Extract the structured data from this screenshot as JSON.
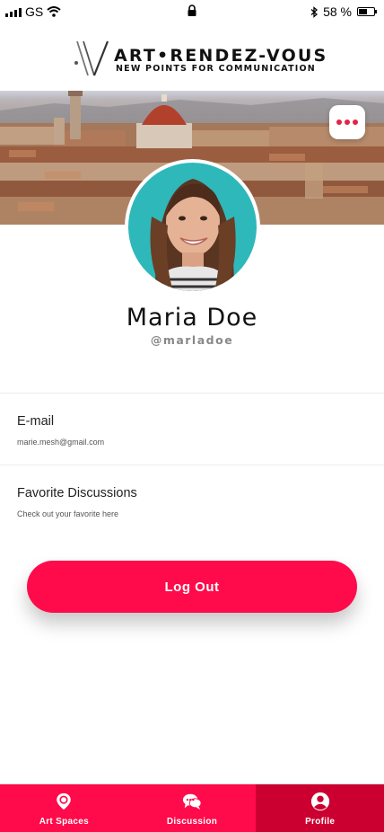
{
  "status_bar": {
    "carrier": "GS",
    "battery_percent": "58 %",
    "battery_level": 0.58
  },
  "brand": {
    "name": "ART•RENDEZ-VOUS",
    "tagline": "NEW POINTS FOR COMMUNICATION"
  },
  "profile": {
    "name": "Maria Doe",
    "handle": "@marladoe"
  },
  "info": [
    {
      "title": "E-mail",
      "subtitle": "marie.mesh@gmail.com"
    },
    {
      "title": "Favorite Discussions",
      "subtitle": "Check out your favorite here"
    }
  ],
  "logout_label": "Log Out",
  "tabs": [
    {
      "label": "Art Spaces",
      "icon": "map-pin-icon",
      "active": false
    },
    {
      "label": "Discussion",
      "icon": "chat-bubbles-icon",
      "active": false
    },
    {
      "label": "Profile",
      "icon": "user-circle-icon",
      "active": true
    }
  ],
  "colors": {
    "accent": "#ff0a4a",
    "accent_active": "#cc0030",
    "dots": "#e0244a"
  }
}
